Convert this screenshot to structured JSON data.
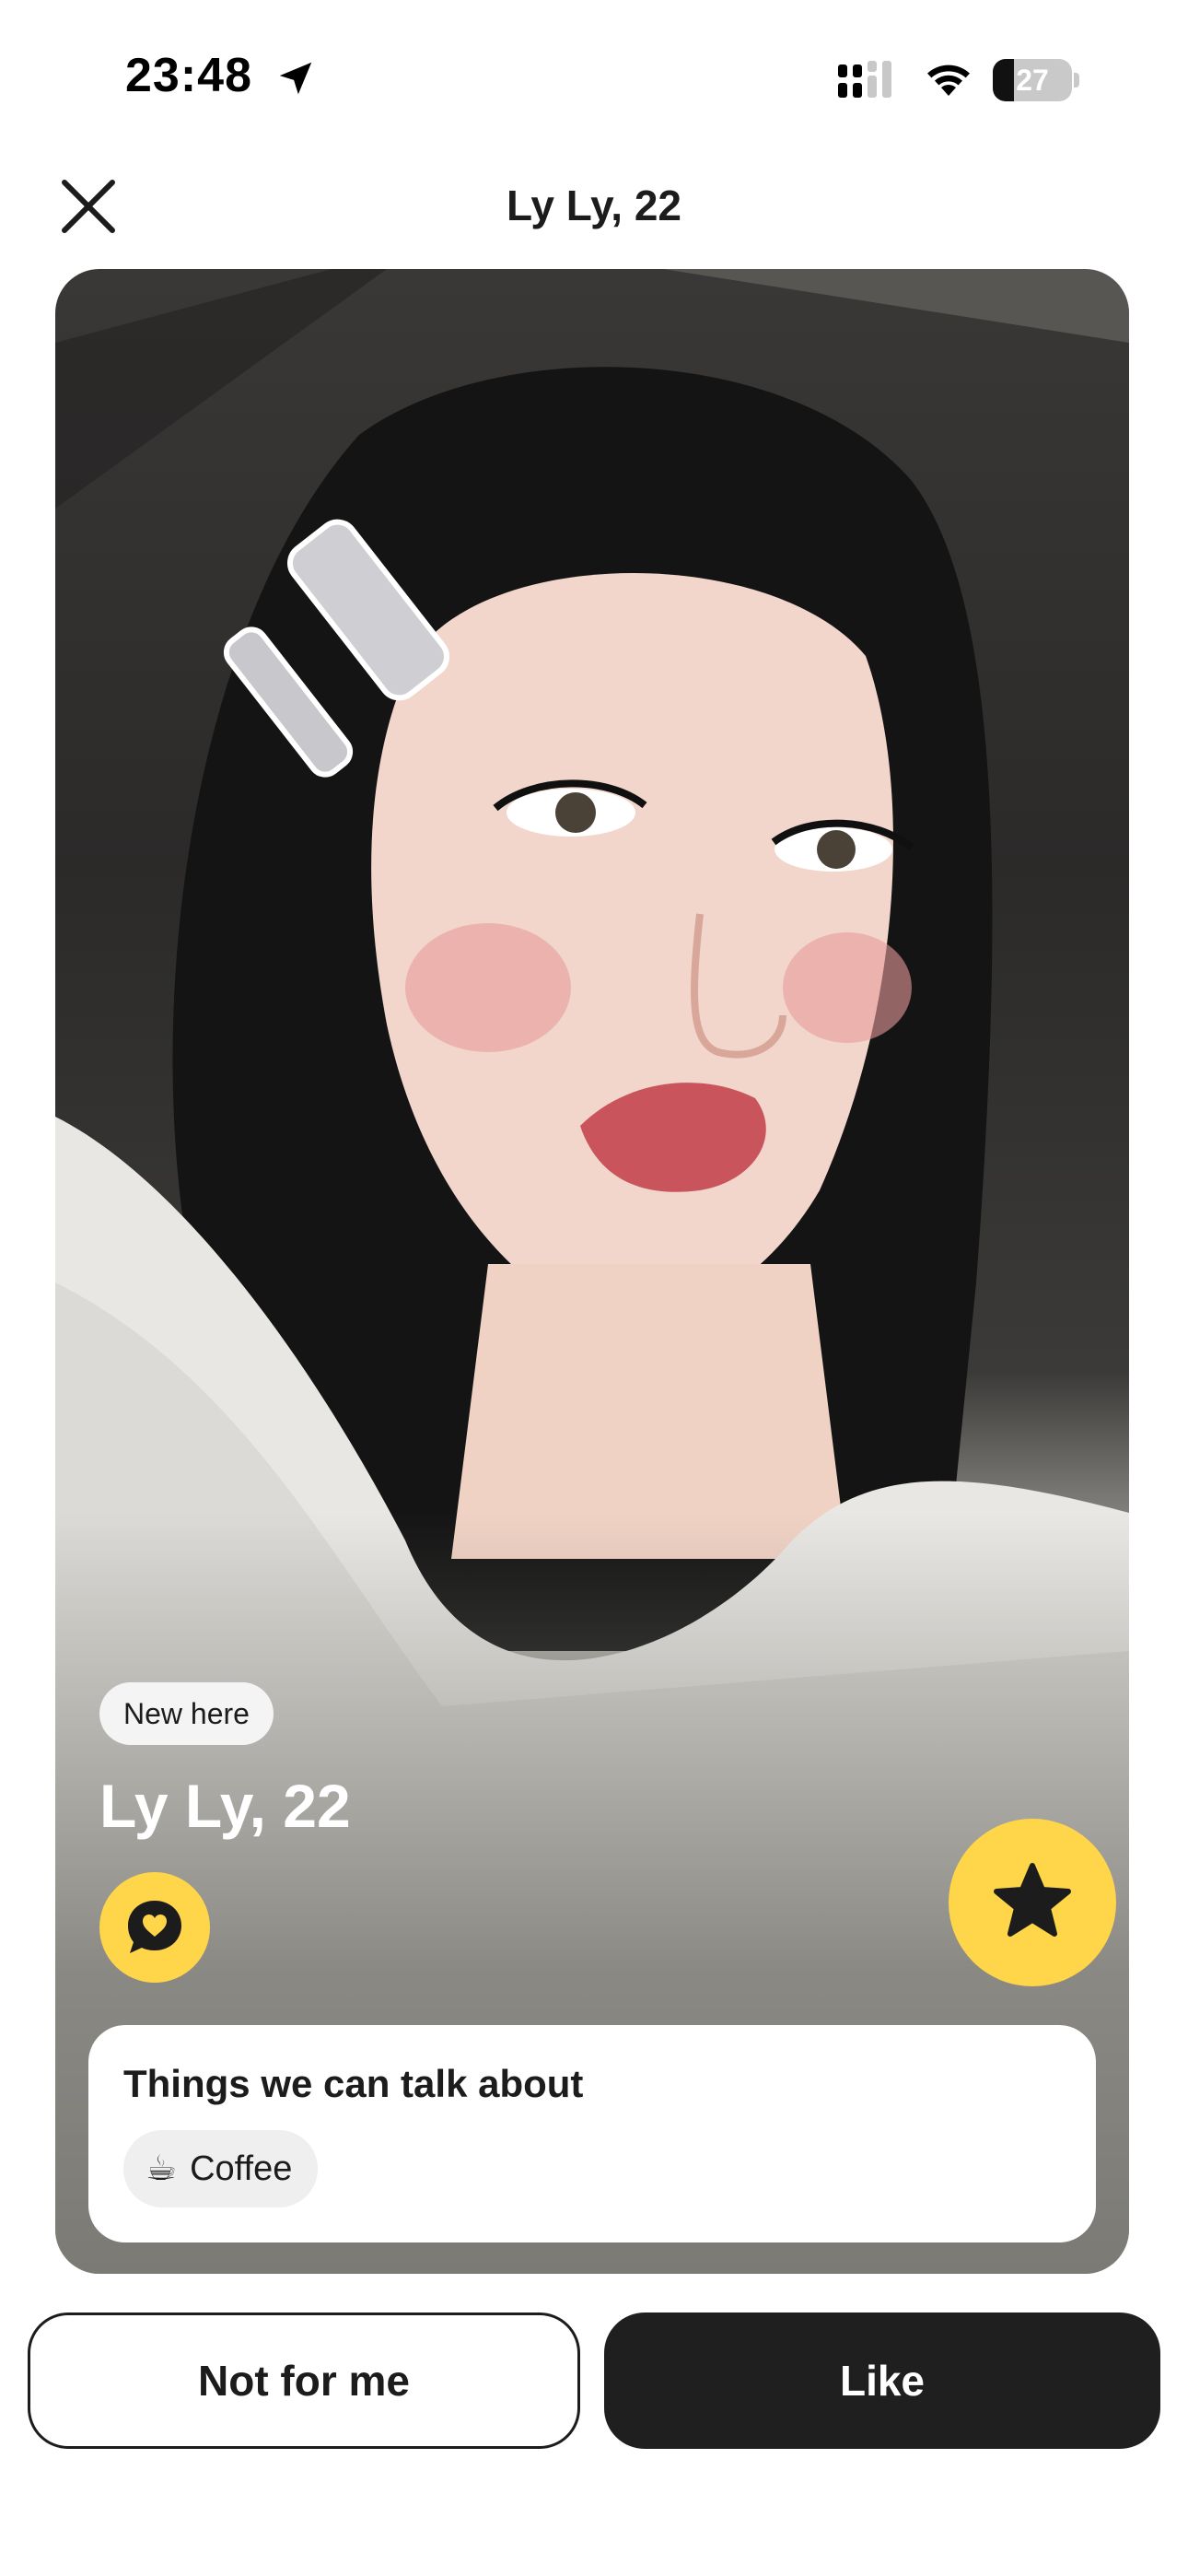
{
  "status_bar": {
    "time": "23:48",
    "battery_level": "27",
    "battery_fraction": 0.27,
    "icons": [
      "location-arrow-icon",
      "cellular-signal-icon",
      "wifi-icon",
      "battery-icon"
    ]
  },
  "header": {
    "title": "Ly Ly, 22",
    "close_icon": "close-icon"
  },
  "profile": {
    "badge": "New here",
    "name_age": "Ly Ly, 22",
    "chat_icon": "chat-heart-icon",
    "superlike_icon": "star-icon",
    "talk_about": {
      "title": "Things we can talk about",
      "topics": [
        {
          "emoji": "☕",
          "label": "Coffee"
        }
      ]
    }
  },
  "actions": {
    "pass_label": "Not for me",
    "like_label": "Like"
  },
  "colors": {
    "accent_yellow": "#ffd54a",
    "primary_dark": "#1f1f1f",
    "chip_bg": "#efefef"
  }
}
